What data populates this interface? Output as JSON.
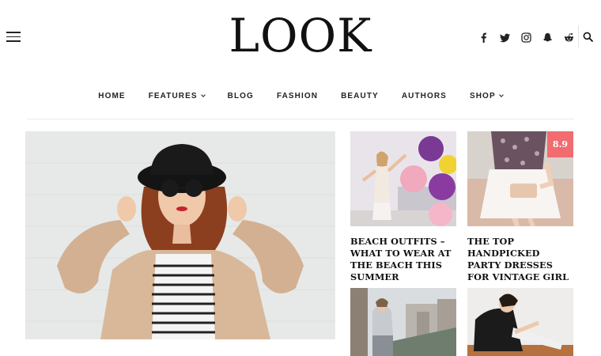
{
  "header": {
    "logo_text": "LOOK",
    "menu_icon": "hamburger-menu-icon",
    "social_icons": [
      "facebook-icon",
      "twitter-icon",
      "instagram-icon",
      "snapchat-icon",
      "reddit-icon"
    ],
    "search_icon": "search-icon"
  },
  "nav": {
    "items": [
      {
        "label": "HOME",
        "has_dropdown": false
      },
      {
        "label": "FEATURES",
        "has_dropdown": true
      },
      {
        "label": "BLOG",
        "has_dropdown": false
      },
      {
        "label": "FASHION",
        "has_dropdown": false
      },
      {
        "label": "BEAUTY",
        "has_dropdown": false
      },
      {
        "label": "AUTHORS",
        "has_dropdown": false
      },
      {
        "label": "SHOP",
        "has_dropdown": true
      }
    ]
  },
  "posts": [
    {
      "title": "BEACH OUTFITS – WHAT TO WEAR AT THE BEACH THIS SUMMER",
      "score": ""
    },
    {
      "title": "THE TOP HANDPICKED PARTY DRESSES FOR VINTAGE GIRL",
      "score": "8.9"
    },
    {
      "title": "",
      "score": ""
    },
    {
      "title": "",
      "score": ""
    }
  ],
  "colors": {
    "accent_score": "#f16b6f",
    "text": "#111111"
  }
}
